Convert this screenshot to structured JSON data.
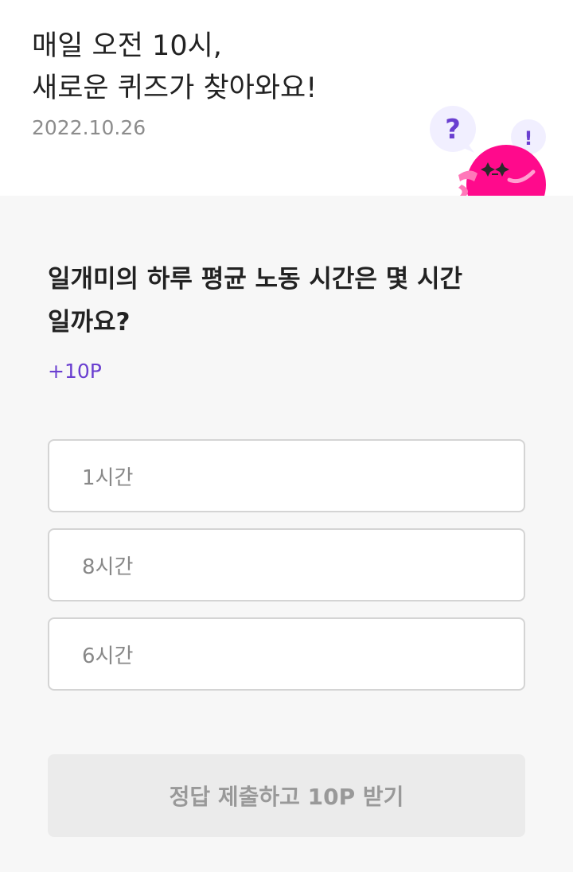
{
  "header": {
    "title_lines": [
      "매일 오전 10시,",
      "새로운 퀴즈가 찾아와요!"
    ],
    "date": "2022.10.26",
    "mascot": {
      "question_bubble_glyph": "?",
      "exclaim_bubble_glyph": "!",
      "icon": "pink-mascot-icon",
      "colors": {
        "body": "#ff0a8c",
        "bubble": "#f1efff",
        "glyph": "#6a3fd0"
      }
    }
  },
  "quiz": {
    "question_lines": [
      "일개미의 하루 평균 노동 시간은 몇 시간",
      "일까요?"
    ],
    "points": "+10P",
    "options": [
      "1시간",
      "8시간",
      "6시간"
    ],
    "submit_label": "정답 제출하고 10P 받기"
  },
  "colors": {
    "accent": "#6a3fd0",
    "background": "#f7f7f7",
    "option_border": "#d4d4d4",
    "button_disabled_bg": "#ebebeb",
    "button_disabled_text": "#999999"
  }
}
